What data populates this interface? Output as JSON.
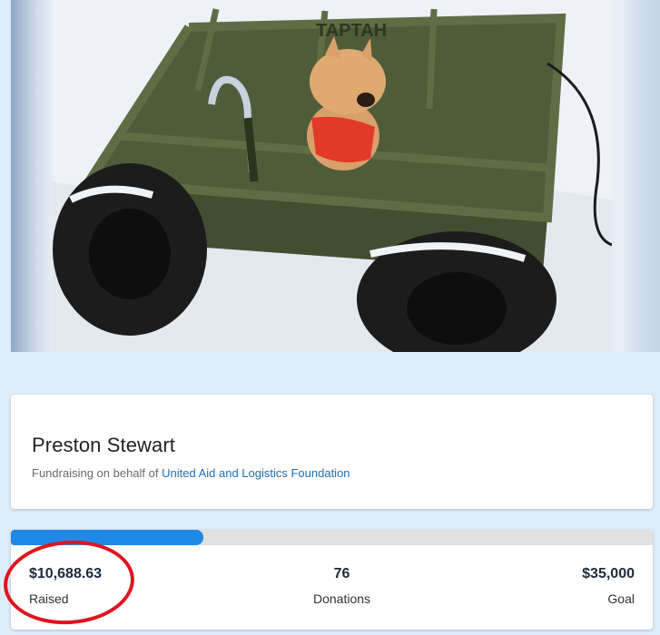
{
  "hero": {
    "icon": "hero-photo"
  },
  "fundraiser": {
    "name": "Preston Stewart",
    "behalf_prefix": "Fundraising on behalf of",
    "organization": "United Aid and Logistics Foundation"
  },
  "stats": {
    "progress_fraction": 0.3,
    "raised_value": "$10,688.63",
    "raised_label": "Raised",
    "donations_value": "76",
    "donations_label": "Donations",
    "goal_value": "$35,000",
    "goal_label": "Goal"
  },
  "colors": {
    "accent": "#1e88e5",
    "link": "#1f6fb3",
    "highlight": "#e0141e",
    "page_bg": "#deebf9"
  }
}
